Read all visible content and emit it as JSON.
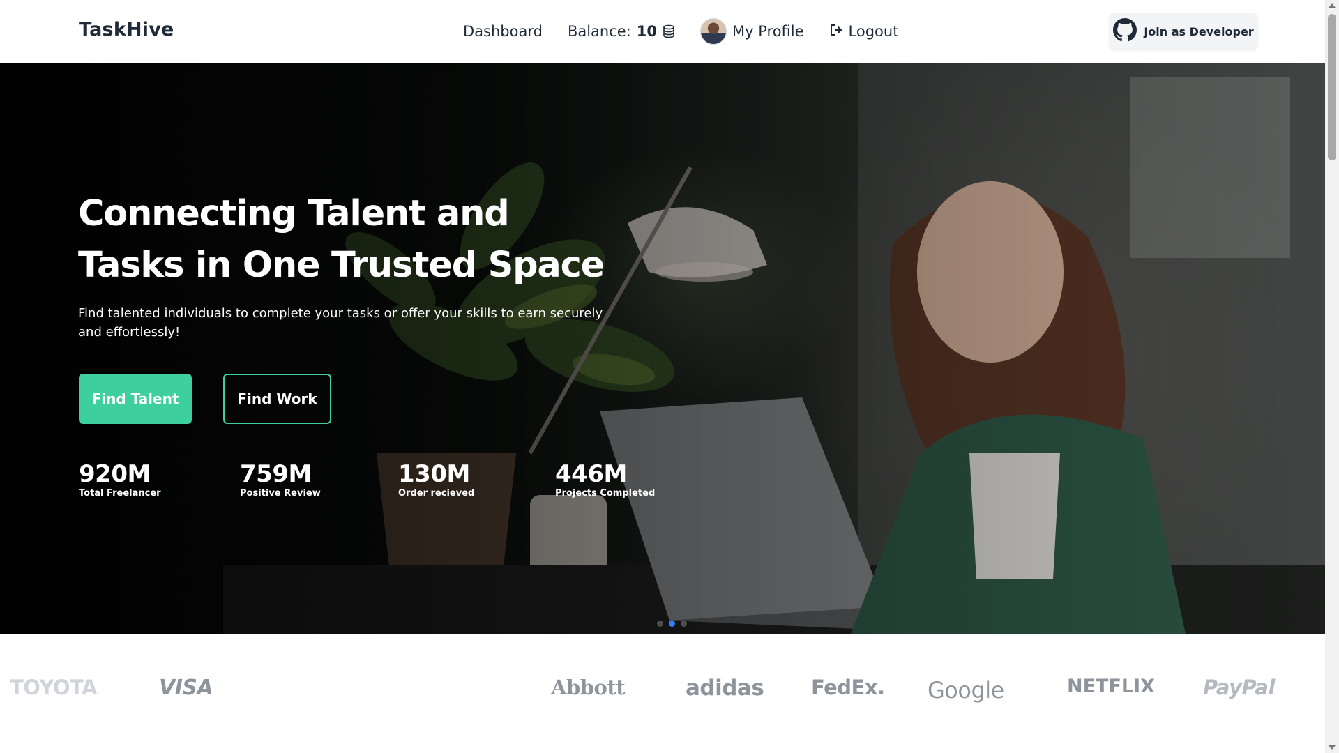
{
  "nav": {
    "brand": "TaskHive",
    "dashboard": "Dashboard",
    "balance_label": "Balance:",
    "balance_value": "10",
    "profile": "My Profile",
    "logout": "Logout",
    "developer_button": "Join as Developer"
  },
  "hero": {
    "title": "Connecting Talent and Tasks in One Trusted Space",
    "subtitle": "Find talented individuals to complete your tasks or offer your skills to earn securely and effortlessly!",
    "primary_button": "Find Talent",
    "secondary_button": "Find Work",
    "stats": [
      {
        "value": "920M",
        "label": "Total Freelancer"
      },
      {
        "value": "759M",
        "label": "Positive Review"
      },
      {
        "value": "130M",
        "label": "Order recieved"
      },
      {
        "value": "446M",
        "label": "Projects Completed"
      }
    ],
    "carousel_active_index": 1
  },
  "logos": [
    "TOYOTA",
    "VISA",
    "Abbott",
    "adidas",
    "FedEx.",
    "Google",
    "NETFLIX",
    "PayPal"
  ],
  "colors": {
    "accent": "#3ecf9e",
    "carousel_dot_active": "#2f80ff",
    "logo_gray": "#8e949b"
  },
  "icons": {
    "coin": "coin-stack-icon",
    "logout": "logout-icon",
    "github": "github-icon",
    "avatar": "avatar"
  }
}
